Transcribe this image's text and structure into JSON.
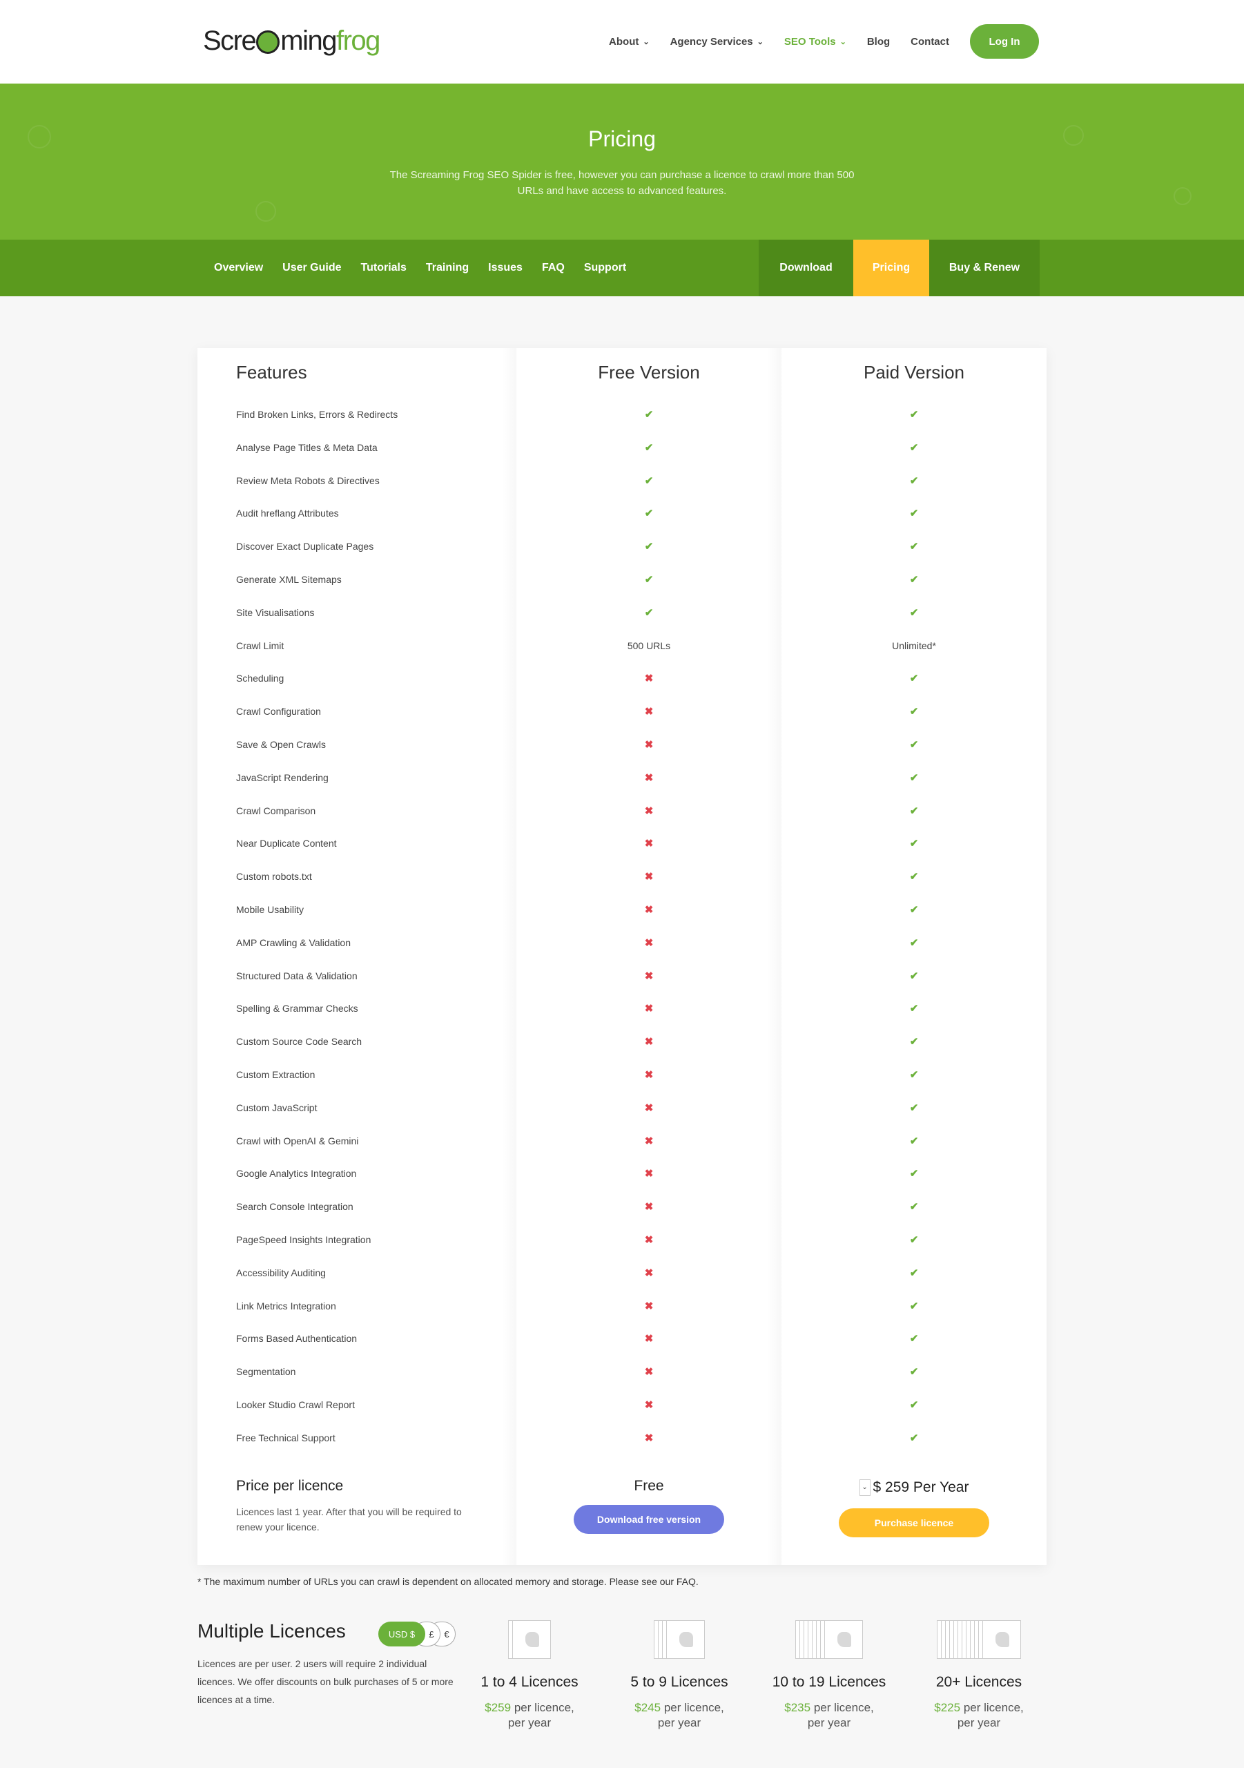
{
  "header": {
    "logo": {
      "pre": "Scre",
      "mid": "ming",
      "post": "frog"
    },
    "nav": [
      {
        "label": "About",
        "dropdown": true,
        "active": false
      },
      {
        "label": "Agency Services",
        "dropdown": true,
        "active": false
      },
      {
        "label": "SEO Tools",
        "dropdown": true,
        "active": true
      },
      {
        "label": "Blog",
        "dropdown": false,
        "active": false
      },
      {
        "label": "Contact",
        "dropdown": false,
        "active": false
      }
    ],
    "login_label": "Log In"
  },
  "hero": {
    "title": "Pricing",
    "subtitle": "The Screaming Frog SEO Spider is free, however you can purchase a licence to crawl more than 500 URLs and have access to advanced features."
  },
  "subnav": {
    "left": [
      "Overview",
      "User Guide",
      "Tutorials",
      "Training",
      "Issues",
      "FAQ",
      "Support"
    ],
    "download": "Download",
    "pricing": "Pricing",
    "buy": "Buy & Renew"
  },
  "table": {
    "headers": {
      "features": "Features",
      "free": "Free Version",
      "paid": "Paid Version"
    },
    "rows": [
      {
        "feature": "Find Broken Links, Errors & Redirects",
        "free": "yes",
        "paid": "yes"
      },
      {
        "feature": "Analyse Page Titles & Meta Data",
        "free": "yes",
        "paid": "yes"
      },
      {
        "feature": "Review Meta Robots & Directives",
        "free": "yes",
        "paid": "yes"
      },
      {
        "feature": "Audit hreflang Attributes",
        "free": "yes",
        "paid": "yes"
      },
      {
        "feature": "Discover Exact Duplicate Pages",
        "free": "yes",
        "paid": "yes"
      },
      {
        "feature": "Generate XML Sitemaps",
        "free": "yes",
        "paid": "yes"
      },
      {
        "feature": "Site Visualisations",
        "free": "yes",
        "paid": "yes"
      },
      {
        "feature": "Crawl Limit",
        "free": "500 URLs",
        "paid": "Unlimited*"
      },
      {
        "feature": "Scheduling",
        "free": "no",
        "paid": "yes"
      },
      {
        "feature": "Crawl Configuration",
        "free": "no",
        "paid": "yes"
      },
      {
        "feature": "Save & Open Crawls",
        "free": "no",
        "paid": "yes"
      },
      {
        "feature": "JavaScript Rendering",
        "free": "no",
        "paid": "yes"
      },
      {
        "feature": "Crawl Comparison",
        "free": "no",
        "paid": "yes"
      },
      {
        "feature": "Near Duplicate Content",
        "free": "no",
        "paid": "yes"
      },
      {
        "feature": "Custom robots.txt",
        "free": "no",
        "paid": "yes"
      },
      {
        "feature": "Mobile Usability",
        "free": "no",
        "paid": "yes"
      },
      {
        "feature": "AMP Crawling & Validation",
        "free": "no",
        "paid": "yes"
      },
      {
        "feature": "Structured Data & Validation",
        "free": "no",
        "paid": "yes"
      },
      {
        "feature": "Spelling & Grammar Checks",
        "free": "no",
        "paid": "yes"
      },
      {
        "feature": "Custom Source Code Search",
        "free": "no",
        "paid": "yes"
      },
      {
        "feature": "Custom Extraction",
        "free": "no",
        "paid": "yes"
      },
      {
        "feature": "Custom JavaScript",
        "free": "no",
        "paid": "yes"
      },
      {
        "feature": "Crawl with OpenAI & Gemini",
        "free": "no",
        "paid": "yes"
      },
      {
        "feature": "Google Analytics Integration",
        "free": "no",
        "paid": "yes"
      },
      {
        "feature": "Search Console Integration",
        "free": "no",
        "paid": "yes"
      },
      {
        "feature": "PageSpeed Insights Integration",
        "free": "no",
        "paid": "yes"
      },
      {
        "feature": "Accessibility Auditing",
        "free": "no",
        "paid": "yes"
      },
      {
        "feature": "Link Metrics Integration",
        "free": "no",
        "paid": "yes"
      },
      {
        "feature": "Forms Based Authentication",
        "free": "no",
        "paid": "yes"
      },
      {
        "feature": "Segmentation",
        "free": "no",
        "paid": "yes"
      },
      {
        "feature": "Looker Studio Crawl Report",
        "free": "no",
        "paid": "yes"
      },
      {
        "feature": "Free Technical Support",
        "free": "no",
        "paid": "yes"
      }
    ],
    "price_title": "Price per licence",
    "price_desc": "Licences last 1 year. After that you will be required to renew your licence.",
    "free_price": "Free",
    "download_free_label": "Download free version",
    "paid_currency_selector": "⌄",
    "paid_price": "$ 259 Per Year",
    "purchase_label": "Purchase licence"
  },
  "footnote": "* The maximum number of URLs you can crawl is dependent on allocated memory and storage. Please see our FAQ.",
  "multiple": {
    "title": "Multiple Licences",
    "currencies": [
      "USD $",
      "£",
      "€"
    ],
    "description": "Licences are per user. 2 users will require 2 individual licences. We offer discounts on bulk purchases of 5 or more licences at a time.",
    "tiers": [
      {
        "title": "1 to 4 Licences",
        "price": "$259",
        "suffix": "per licence,",
        "suffix2": "per year"
      },
      {
        "title": "5 to 9 Licences",
        "price": "$245",
        "suffix": "per licence,",
        "suffix2": "per year"
      },
      {
        "title": "10 to 19 Licences",
        "price": "$235",
        "suffix": "per licence,",
        "suffix2": "per year"
      },
      {
        "title": "20+ Licences",
        "price": "$225",
        "suffix": "per licence,",
        "suffix2": "per year"
      }
    ]
  },
  "colors": {
    "brand_green": "#6bb13a",
    "hero_green": "#76b52f",
    "subnav_green": "#5b9a1e",
    "pricing_yellow": "#ffbf2a",
    "cross_red": "#e0414b",
    "download_blue": "#6f7ae0"
  },
  "icons": {
    "yes": "check-icon",
    "no": "cross-icon",
    "dropdown": "chevron-down-icon"
  }
}
